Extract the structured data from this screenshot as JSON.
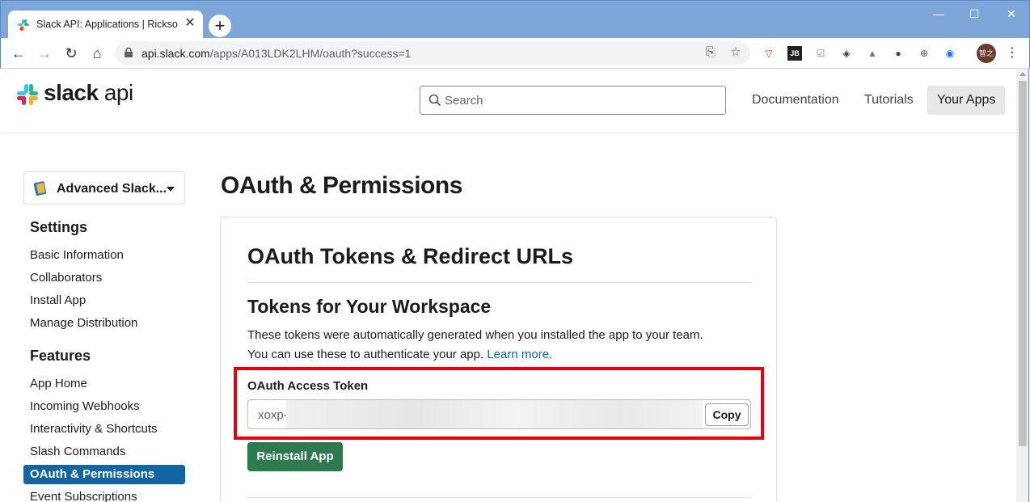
{
  "browser": {
    "tab_title": "Slack API: Applications | Ricksoft",
    "tab_close": "✕",
    "new_tab": "+",
    "url_host": "api.slack.com",
    "url_path": "/apps/A013LDK2LHM/oauth?success=1",
    "avatar_text": "智之",
    "window_controls": [
      "—",
      "☐",
      "✕"
    ]
  },
  "header": {
    "logo_bold": "slack",
    "logo_light": " api",
    "search_placeholder": "Search",
    "nav": [
      "Documentation",
      "Tutorials",
      "Your Apps"
    ]
  },
  "sidebar": {
    "app_name": "Advanced Slack...",
    "settings_heading": "Settings",
    "settings_items": [
      "Basic Information",
      "Collaborators",
      "Install App",
      "Manage Distribution"
    ],
    "features_heading": "Features",
    "features_items": [
      "App Home",
      "Incoming Webhooks",
      "Interactivity & Shortcuts",
      "Slash Commands",
      "OAuth & Permissions",
      "Event Subscriptions"
    ]
  },
  "main": {
    "page_title": "OAuth & Permissions",
    "card_title": "OAuth Tokens & Redirect URLs",
    "section_title": "Tokens for Your Workspace",
    "desc_line1": "These tokens were automatically generated when you installed the app to your team.",
    "desc_line2": "You can use these to authenticate your app.",
    "learn_more": "Learn more.",
    "token_label": "OAuth Access Token",
    "token_prefix": "xoxp-",
    "copy_label": "Copy",
    "reinstall_label": "Reinstall App"
  },
  "colors": {
    "accent": "#1264a3",
    "reinstall": "#2e7a4f",
    "highlight": "#e3000f"
  }
}
